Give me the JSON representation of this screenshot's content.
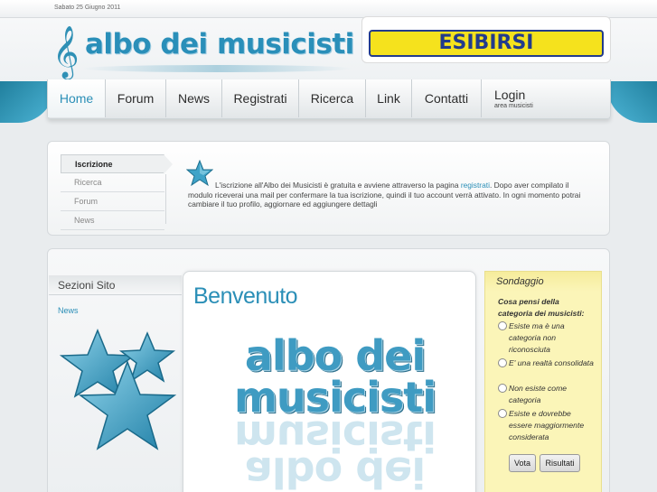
{
  "topbar": {
    "date": "Sabato 25 Giugno 2011"
  },
  "header": {
    "logo_text": "albo dei musicisti",
    "clef_glyph": "𝄞",
    "banner_text": "ESIBIRSI"
  },
  "nav": {
    "items": [
      {
        "label": "Home",
        "active": true
      },
      {
        "label": "Forum"
      },
      {
        "label": "News"
      },
      {
        "label": "Registrati"
      },
      {
        "label": "Ricerca"
      },
      {
        "label": "Link"
      },
      {
        "label": "Contatti"
      }
    ],
    "login": {
      "label": "Login",
      "sub": "area musicisti"
    }
  },
  "info": {
    "menu": [
      "Iscrizione",
      "Ricerca",
      "Forum",
      "News"
    ],
    "text_before": "L'iscrizione all'Albo dei Musicisti è gratuita e avviene attraverso la pagina ",
    "link": "registrati",
    "text_after": ". Dopo aver compilato il modulo riceverai una mail per confermare la tua iscrizione, quindi il tuo account verrà attivato. In ogni momento potrai cambiare il tuo profilo, aggiornare ed aggiungere dettagli"
  },
  "sections": {
    "title": "Sezioni Sito",
    "link": "News"
  },
  "content": {
    "title": "Benvenuto",
    "logo_line1": "albo dei",
    "logo_line2": "musicisti"
  },
  "poll": {
    "title": "Sondaggio",
    "question": "Cosa pensi della categoria dei musicisti:",
    "options": [
      "Esiste ma è una categoria non riconosciuta",
      "E' una realtà consolidata",
      "Non esiste come categoria",
      "Esiste e dovrebbe essere maggiormente considerata"
    ],
    "vote_button": "Vota",
    "results_button": "Risultati"
  },
  "colors": {
    "accent": "#2b8fb7",
    "banner_bg": "#f5e21d",
    "banner_text": "#223b8c",
    "poll_bg": "#fbf5b8"
  }
}
